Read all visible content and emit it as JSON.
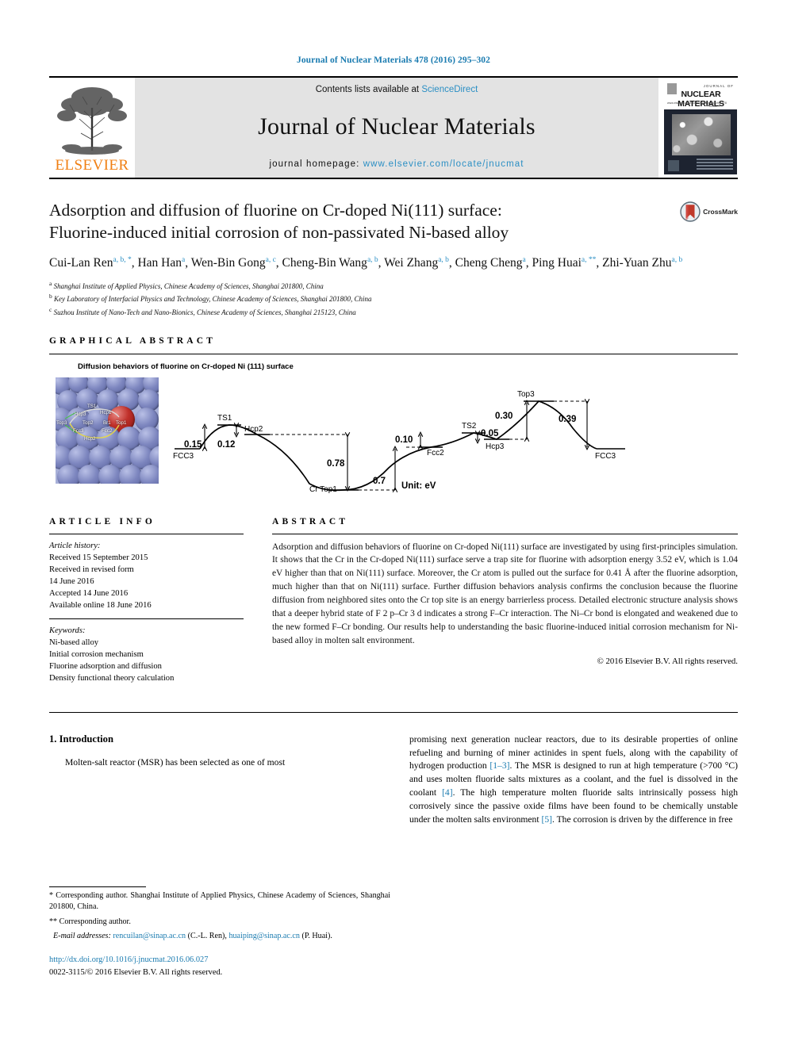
{
  "running_head": "Journal of Nuclear Materials 478 (2016) 295–302",
  "masthead": {
    "publisher": "ELSEVIER",
    "contents_prefix": "Contents lists available at ",
    "contents_link": "ScienceDirect",
    "journal_title": "Journal of Nuclear Materials",
    "homepage_prefix": "journal homepage: ",
    "homepage_url": "www.elsevier.com/locate/jnucmat",
    "cover": {
      "journal_word": "JOURNAL OF",
      "name": "NUCLEAR MATERIALS",
      "left_sub": "www.elsevier.com/locate/jnucmat",
      "right_sub": "VOLUME 478  ISSUE 1"
    }
  },
  "article": {
    "title_line1": "Adsorption and diffusion of fluorine on Cr-doped Ni(111) surface:",
    "title_line2": "Fluorine-induced initial corrosion of non-passivated Ni-based alloy",
    "crossmark_label": "CrossMark",
    "authors": [
      {
        "name": "Cui-Lan Ren",
        "sup": "a, b, *"
      },
      {
        "name": "Han Han",
        "sup": "a"
      },
      {
        "name": "Wen-Bin Gong",
        "sup": "a, c"
      },
      {
        "name": "Cheng-Bin Wang",
        "sup": "a, b"
      },
      {
        "name": "Wei Zhang",
        "sup": "a, b"
      },
      {
        "name": "Cheng Cheng",
        "sup": "a"
      },
      {
        "name": "Ping Huai",
        "sup": "a, **"
      },
      {
        "name": "Zhi-Yuan Zhu",
        "sup": "a, b"
      }
    ],
    "affiliations": [
      {
        "sup": "a",
        "text": "Shanghai Institute of Applied Physics, Chinese Academy of Sciences, Shanghai 201800, China"
      },
      {
        "sup": "b",
        "text": "Key Laboratory of Interfacial Physics and Technology, Chinese Academy of Sciences, Shanghai 201800, China"
      },
      {
        "sup": "c",
        "text": "Suzhou Institute of Nano-Tech and Nano-Bionics, Chinese Academy of Sciences, Shanghai 215123, China"
      }
    ]
  },
  "graphical_abstract": {
    "heading": "GRAPHICAL ABSTRACT",
    "caption": "Diffusion behaviors of fluorine on Cr-doped Ni (111)  surface",
    "unit_label": "Unit: eV",
    "slab_labels": [
      "TS1",
      "Hcp3",
      "Hcp1",
      "Top3",
      "Top2",
      "Br1",
      "Top1",
      "Fcc3",
      "Fcc2",
      "Hcp2"
    ],
    "energy_profile": {
      "states": [
        "FCC3",
        "TS1",
        "Hcp2",
        "Cr Top1",
        "Fcc2",
        "TS2",
        "Hcp3",
        "Top3",
        "FCC3"
      ],
      "barriers": [
        "0.15",
        "0.12",
        "0.78",
        "0.7",
        "0.10",
        "0.05",
        "0.30",
        "0.39"
      ]
    }
  },
  "article_info": {
    "heading": "ARTICLE INFO",
    "history_label": "Article history:",
    "history": [
      "Received 15 September 2015",
      "Received in revised form",
      "14 June 2016",
      "Accepted 14 June 2016",
      "Available online 18 June 2016"
    ],
    "keywords_label": "Keywords:",
    "keywords": [
      "Ni-based alloy",
      "Initial corrosion mechanism",
      "Fluorine adsorption and diffusion",
      "Density functional theory calculation"
    ]
  },
  "abstract": {
    "heading": "ABSTRACT",
    "text": "Adsorption and diffusion behaviors of fluorine on Cr-doped Ni(111) surface are investigated by using first-principles simulation. It shows that the Cr in the Cr-doped Ni(111) surface serve a trap site for fluorine with adsorption energy 3.52 eV, which is 1.04 eV higher than that on Ni(111) surface. Moreover, the Cr atom is pulled out the surface for 0.41 Å after the fluorine adsorption, much higher than that on Ni(111) surface. Further diffusion behaviors analysis confirms the conclusion because the fluorine diffusion from neighbored sites onto the Cr top site is an energy barrierless process. Detailed electronic structure analysis shows that a deeper hybrid state of F 2 p–Cr 3 d indicates a strong F–Cr interaction. The Ni–Cr bond is elongated and weakened due to the new formed F–Cr bonding. Our results help to understanding the basic fluorine-induced initial corrosion mechanism for Ni-based alloy in molten salt environment.",
    "copyright": "© 2016 Elsevier B.V. All rights reserved."
  },
  "body": {
    "section_number_title": "1.  Introduction",
    "left_paragraph": "Molten-salt reactor (MSR) has been selected as one of most",
    "right_paragraph_parts": [
      "promising next generation nuclear reactors, due to its desirable properties of online refueling and burning of miner actinides in spent fuels, along with the capability of hydrogen production ",
      "[1–3]",
      ". The MSR is designed to run at high temperature (>700 °C) and uses molten fluoride salts mixtures as a coolant, and the fuel is dissolved in the coolant ",
      "[4]",
      ". The high temperature molten fluoride salts intrinsically possess high corrosively since the passive oxide films have been found to be chemically unstable under the molten salts environment ",
      "[5]",
      ". The corrosion is driven by the difference in free"
    ]
  },
  "footnotes": {
    "corresponding_1": "* Corresponding author. Shanghai Institute of Applied Physics, Chinese Academy of Sciences, Shanghai 201800, China.",
    "corresponding_2": "** Corresponding author.",
    "email_label": "E-mail addresses:",
    "email_1": "rencuilan@sinap.ac.cn",
    "email_1_owner": "(C.-L. Ren)",
    "email_2": "huaiping@sinap.ac.cn",
    "email_2_owner": "(P. Huai).",
    "doi": "http://dx.doi.org/10.1016/j.jnucmat.2016.06.027",
    "issn_line": "0022-3115/© 2016 Elsevier B.V. All rights reserved."
  },
  "colors": {
    "link_blue": "#1a7bb0",
    "sciencedirect_blue": "#2b8fc4",
    "elsevier_orange": "#f07f13",
    "masthead_grey": "#e3e3e3",
    "ni_atom": "#7d86bf",
    "cr_atom": "#c0302a"
  }
}
